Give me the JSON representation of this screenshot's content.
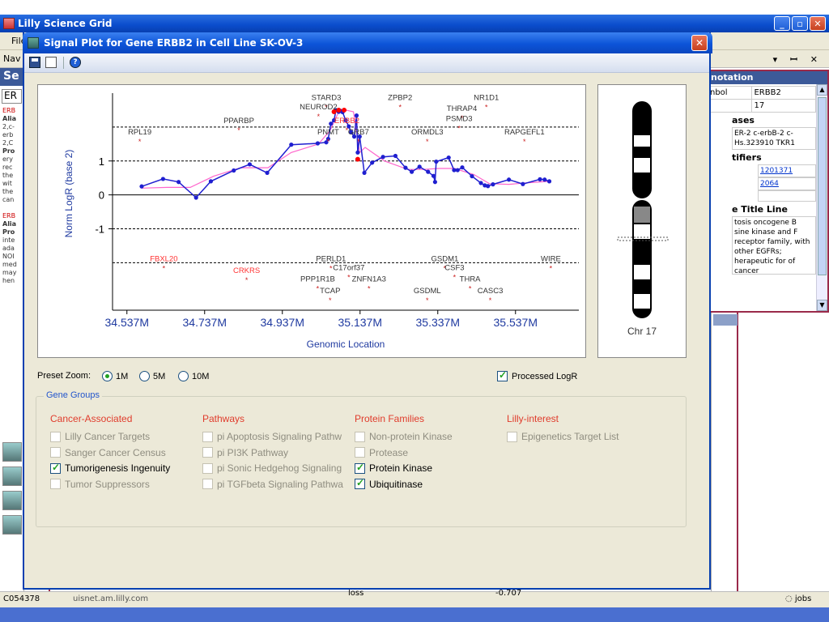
{
  "app": {
    "title": "Lilly Science Grid",
    "menu_first": "File",
    "nav_label": "Nav",
    "pin_controls": "▾ ꟷ ✕"
  },
  "left_panel": {
    "header": "Se",
    "search_value": "ER",
    "lines": [
      "ERB",
      "Alia",
      "2,c-",
      "erb",
      "2,C",
      "Pro",
      "ery",
      "rec",
      "the",
      "wit",
      "the",
      "can",
      "",
      "ERB",
      "Alia",
      "Pro",
      "inte",
      "ada",
      "NOI",
      "med",
      "may",
      "hen"
    ]
  },
  "annotation_panel": {
    "header": "notation",
    "rows": [
      {
        "k": "nbol",
        "v": "ERBB2"
      },
      {
        "k": "",
        "v": "17"
      }
    ],
    "aliases_title": "ases",
    "aliases_text": "ER-2 c-erbB-2 c-Hs.323910 TKR1",
    "identifiers_title": "tifiers",
    "identifier_links": [
      "1201371",
      "2064"
    ],
    "title_line_title": "e Title Line",
    "description": "tosis oncogene B sine kinase and F receptor family, with other EGFRs; herapeutic for of cancer"
  },
  "status_bar": {
    "user": "C054378",
    "host": "uisnet.am.lilly.com",
    "loss": "loss",
    "value": "-0.707",
    "jobs": "jobs"
  },
  "dialog": {
    "title": "Signal Plot for Gene ERBB2 in Cell Line SK-OV-3",
    "close_label": "✕",
    "help_glyph": "?",
    "preset_zoom_label": "Preset Zoom:",
    "zoom_options": [
      {
        "label": "1M",
        "selected": true
      },
      {
        "label": "5M",
        "selected": false
      },
      {
        "label": "10M",
        "selected": false
      }
    ],
    "processed_logr": {
      "label": "Processed LogR",
      "checked": true
    },
    "gene_groups_label": "Gene Groups",
    "groups": [
      {
        "title": "Cancer-Associated",
        "items": [
          {
            "label": "Lilly Cancer Targets",
            "checked": false
          },
          {
            "label": "Sanger Cancer Census",
            "checked": false
          },
          {
            "label": "Tumorigenesis Ingenuity",
            "checked": true
          },
          {
            "label": "Tumor Suppressors",
            "checked": false
          }
        ]
      },
      {
        "title": "Pathways",
        "items": [
          {
            "label": "pi Apoptosis Signaling Pathw",
            "checked": false
          },
          {
            "label": "pi PI3K Pathway",
            "checked": false
          },
          {
            "label": "pi Sonic Hedgehog Signaling",
            "checked": false
          },
          {
            "label": "pi TGFbeta Signaling Pathwa",
            "checked": false
          }
        ]
      },
      {
        "title": "Protein Families",
        "items": [
          {
            "label": "Non-protein Kinase",
            "checked": false
          },
          {
            "label": "Protease",
            "checked": false
          },
          {
            "label": "Protein Kinase",
            "checked": true
          },
          {
            "label": "Ubiquitinase",
            "checked": true
          }
        ]
      },
      {
        "title": "Lilly-interest",
        "items": [
          {
            "label": "Epigenetics Target List",
            "checked": false
          }
        ]
      }
    ]
  },
  "chromosome": {
    "label": "Chr 17"
  },
  "chart_data": {
    "type": "line",
    "xlabel": "Genomic Location",
    "ylabel": "Norm LogR (base 2)",
    "xlim": [
      34.5,
      35.7
    ],
    "ylim": [
      -3.4,
      3.0
    ],
    "x_ticks": [
      {
        "value": 34.537,
        "label": "34.537M"
      },
      {
        "value": 34.737,
        "label": "34.737M"
      },
      {
        "value": 34.937,
        "label": "34.937M"
      },
      {
        "value": 35.137,
        "label": "35.137M"
      },
      {
        "value": 35.337,
        "label": "35.337M"
      },
      {
        "value": 35.537,
        "label": "35.537M"
      }
    ],
    "y_ticks": [
      {
        "value": 1,
        "label": "1"
      },
      {
        "value": 0,
        "label": "0"
      },
      {
        "value": -1,
        "label": "-1"
      }
    ],
    "reference_lines": [
      2,
      1,
      -1,
      -2
    ],
    "series": [
      {
        "color": "#1f1fd0",
        "x": [
          34.575,
          34.63,
          34.67,
          34.715,
          34.753,
          34.812,
          34.853,
          34.898,
          34.96,
          35.028,
          35.05,
          35.055,
          35.062,
          35.07,
          35.075,
          35.082,
          35.086,
          35.092,
          35.1,
          35.108,
          35.114,
          35.122,
          35.128,
          35.131,
          35.136,
          35.148,
          35.168,
          35.196,
          35.228,
          35.254,
          35.27,
          35.29,
          35.312,
          35.326,
          35.33,
          35.333,
          35.365,
          35.379,
          35.388,
          35.4,
          35.425,
          35.448,
          35.458,
          35.466,
          35.479,
          35.52,
          35.556,
          35.6,
          35.612,
          35.624
        ],
        "y": [
          0.25,
          0.47,
          0.38,
          -0.08,
          0.4,
          0.72,
          0.9,
          0.65,
          1.48,
          1.52,
          1.55,
          1.65,
          2.1,
          2.2,
          2.5,
          2.45,
          2.48,
          2.44,
          2.2,
          2.02,
          1.85,
          1.72,
          2.34,
          1.25,
          1.72,
          0.65,
          0.95,
          1.12,
          1.15,
          0.8,
          0.68,
          0.83,
          0.68,
          0.56,
          0.38,
          0.98,
          1.1,
          0.73,
          0.73,
          0.81,
          0.55,
          0.35,
          0.28,
          0.26,
          0.31,
          0.45,
          0.32,
          0.46,
          0.45,
          0.4
        ]
      },
      {
        "color": "#ff66cc",
        "x": [
          34.575,
          34.64,
          34.7,
          34.76,
          34.83,
          34.9,
          34.96,
          35.03,
          35.06,
          35.08,
          35.1,
          35.12,
          35.136,
          35.15,
          35.2,
          35.26,
          35.3,
          35.34,
          35.38,
          35.43,
          35.47,
          35.52,
          35.57,
          35.624
        ],
        "y": [
          0.2,
          0.22,
          0.22,
          0.55,
          0.8,
          0.8,
          1.25,
          1.5,
          1.9,
          2.4,
          2.5,
          2.45,
          1.25,
          1.4,
          1.0,
          0.75,
          0.75,
          0.78,
          0.78,
          0.6,
          0.33,
          0.31,
          0.36,
          0.4
        ]
      }
    ],
    "highlight_points": [
      {
        "x": 35.07,
        "y": 2.45,
        "color": "#ff0000"
      },
      {
        "x": 35.082,
        "y": 2.5,
        "color": "#ff0000"
      },
      {
        "x": 35.096,
        "y": 2.5,
        "color": "#ff0000"
      },
      {
        "x": 35.131,
        "y": 1.05,
        "color": "#ff0000"
      }
    ],
    "gene_labels": [
      {
        "name": "STARD3",
        "x": 35.05,
        "y": 2.8,
        "color": "#333333"
      },
      {
        "name": "NEUROD2",
        "x": 35.03,
        "y": 2.52,
        "color": "#333333"
      },
      {
        "name": "ERBB2",
        "x": 35.103,
        "y": 2.12,
        "color": "#ff3333"
      },
      {
        "name": "PNMT",
        "x": 35.055,
        "y": 1.78,
        "color": "#333333"
      },
      {
        "name": "GRB7",
        "x": 35.133,
        "y": 1.78,
        "color": "#333333"
      },
      {
        "name": "ZPBP2",
        "x": 35.24,
        "y": 2.8,
        "color": "#333333"
      },
      {
        "name": "NR1D1",
        "x": 35.462,
        "y": 2.8,
        "color": "#333333"
      },
      {
        "name": "THRAP4",
        "x": 35.399,
        "y": 2.48,
        "color": "#333333"
      },
      {
        "name": "PSMD3",
        "x": 35.392,
        "y": 2.18,
        "color": "#333333"
      },
      {
        "name": "ORMDL3",
        "x": 35.31,
        "y": 1.78,
        "color": "#333333"
      },
      {
        "name": "RAPGEFL1",
        "x": 35.56,
        "y": 1.78,
        "color": "#333333"
      },
      {
        "name": "PPARBP",
        "x": 34.825,
        "y": 2.12,
        "color": "#333333"
      },
      {
        "name": "RPL19",
        "x": 34.57,
        "y": 1.78,
        "color": "#333333"
      },
      {
        "name": "FBXL20",
        "x": 34.632,
        "y": -1.95,
        "color": "#ff3333"
      },
      {
        "name": "CRKRS",
        "x": 34.845,
        "y": -2.3,
        "color": "#ff3333"
      },
      {
        "name": "PERLD1",
        "x": 35.062,
        "y": -1.95,
        "color": "#333333"
      },
      {
        "name": "C17orf37",
        "x": 35.108,
        "y": -2.22,
        "color": "#333333"
      },
      {
        "name": "PPP1R1B",
        "x": 35.028,
        "y": -2.55,
        "color": "#333333"
      },
      {
        "name": "ZNFN1A3",
        "x": 35.16,
        "y": -2.55,
        "color": "#333333"
      },
      {
        "name": "TCAP",
        "x": 35.06,
        "y": -2.9,
        "color": "#333333"
      },
      {
        "name": "GSDM1",
        "x": 35.355,
        "y": -1.95,
        "color": "#333333"
      },
      {
        "name": "CSF3",
        "x": 35.38,
        "y": -2.22,
        "color": "#333333"
      },
      {
        "name": "THRA",
        "x": 35.42,
        "y": -2.55,
        "color": "#333333"
      },
      {
        "name": "GSDML",
        "x": 35.31,
        "y": -2.9,
        "color": "#333333"
      },
      {
        "name": "CASC3",
        "x": 35.472,
        "y": -2.9,
        "color": "#333333"
      },
      {
        "name": "WIRE",
        "x": 35.628,
        "y": -1.95,
        "color": "#333333"
      }
    ],
    "grid": false
  }
}
